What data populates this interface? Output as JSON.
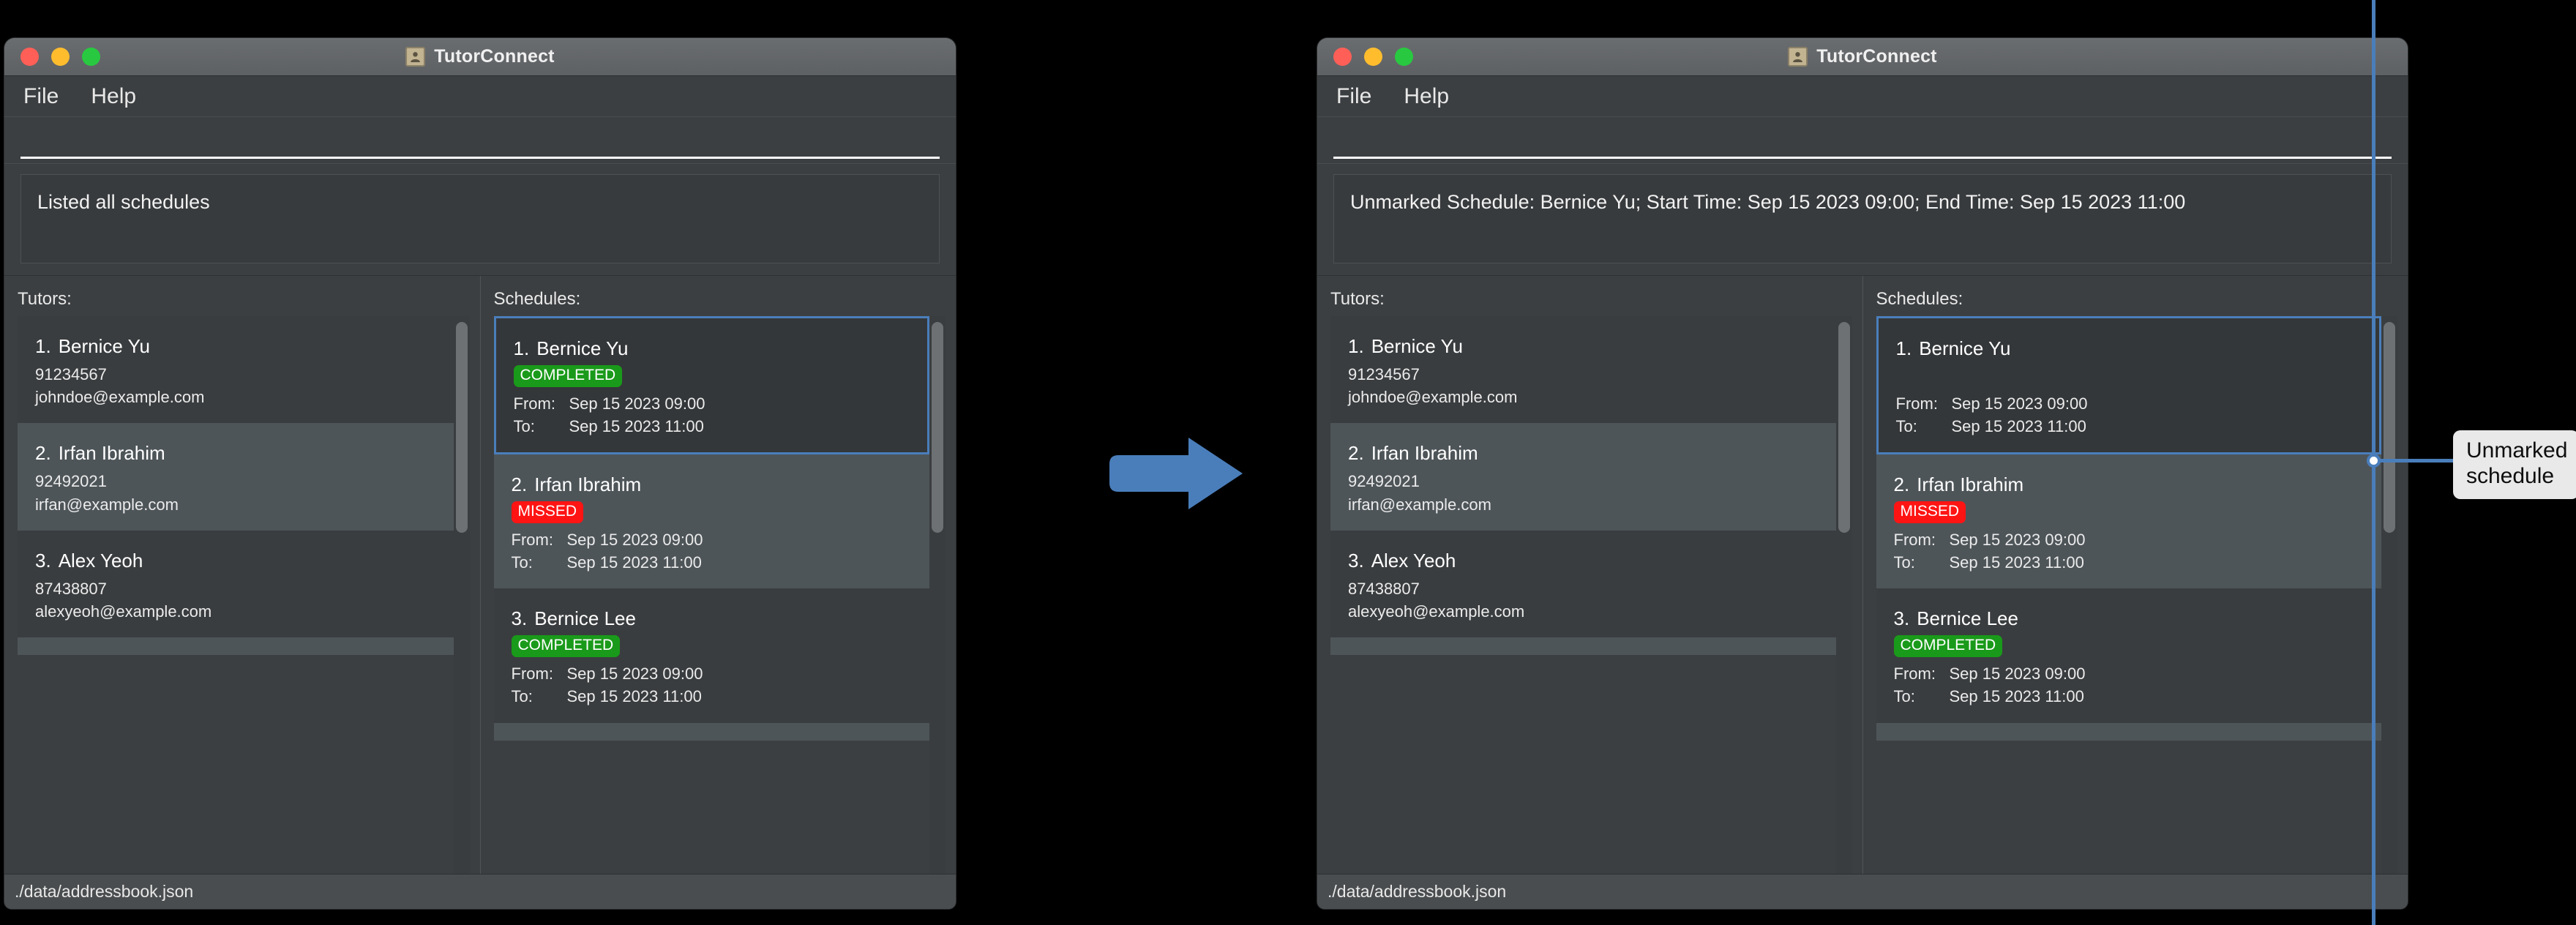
{
  "window_title": "TutorConnect",
  "app_icon": "contact-person-icon",
  "menu": {
    "file": "File",
    "help": "Help"
  },
  "command_input": {
    "value": "",
    "placeholder": ""
  },
  "panels": {
    "tutors_title": "Tutors:",
    "schedules_title": "Schedules:"
  },
  "status_bar": {
    "path": "./data/addressbook.json"
  },
  "arrow": {
    "name": "right-arrow",
    "color": "#4a7ebb"
  },
  "callout": {
    "line1": "Unmarked",
    "line2": "schedule",
    "color": "#4a7ebb",
    "label_bg": "#e9e9e9"
  },
  "colors": {
    "accent_blue": "#4a7ebb",
    "completed_green": "#1a9a1a",
    "missed_red": "#ff1414",
    "window_bg": "#3c3f41",
    "card_odd": "#3a3d3f",
    "card_even": "#4e5559"
  },
  "left": {
    "result": "Listed all schedules",
    "tutors": [
      {
        "index": "1.",
        "name": "Bernice Yu",
        "phone": "91234567",
        "email": "johndoe@example.com"
      },
      {
        "index": "2.",
        "name": "Irfan Ibrahim",
        "phone": "92492021",
        "email": "irfan@example.com"
      },
      {
        "index": "3.",
        "name": "Alex Yeoh",
        "phone": "87438807",
        "email": "alexyeoh@example.com"
      }
    ],
    "schedules": [
      {
        "index": "1.",
        "name": "Bernice Yu",
        "status": "COMPLETED",
        "from_label": "From:",
        "from": "Sep 15 2023 09:00",
        "to_label": "To:",
        "to": "Sep 15 2023 11:00"
      },
      {
        "index": "2.",
        "name": "Irfan Ibrahim",
        "status": "MISSED",
        "from_label": "From:",
        "from": "Sep 15 2023 09:00",
        "to_label": "To:",
        "to": "Sep 15 2023 11:00"
      },
      {
        "index": "3.",
        "name": "Bernice Lee",
        "status": "COMPLETED",
        "from_label": "From:",
        "from": "Sep 15 2023 09:00",
        "to_label": "To:",
        "to": "Sep 15 2023 11:00"
      }
    ]
  },
  "right": {
    "result": "Unmarked Schedule: Bernice Yu; Start Time: Sep 15 2023 09:00; End Time: Sep 15 2023 11:00",
    "tutors": [
      {
        "index": "1.",
        "name": "Bernice Yu",
        "phone": "91234567",
        "email": "johndoe@example.com"
      },
      {
        "index": "2.",
        "name": "Irfan Ibrahim",
        "phone": "92492021",
        "email": "irfan@example.com"
      },
      {
        "index": "3.",
        "name": "Alex Yeoh",
        "phone": "87438807",
        "email": "alexyeoh@example.com"
      }
    ],
    "schedules": [
      {
        "index": "1.",
        "name": "Bernice Yu",
        "status": "",
        "from_label": "From:",
        "from": "Sep 15 2023 09:00",
        "to_label": "To:",
        "to": "Sep 15 2023 11:00"
      },
      {
        "index": "2.",
        "name": "Irfan Ibrahim",
        "status": "MISSED",
        "from_label": "From:",
        "from": "Sep 15 2023 09:00",
        "to_label": "To:",
        "to": "Sep 15 2023 11:00"
      },
      {
        "index": "3.",
        "name": "Bernice Lee",
        "status": "COMPLETED",
        "from_label": "From:",
        "from": "Sep 15 2023 09:00",
        "to_label": "To:",
        "to": "Sep 15 2023 11:00"
      }
    ]
  }
}
